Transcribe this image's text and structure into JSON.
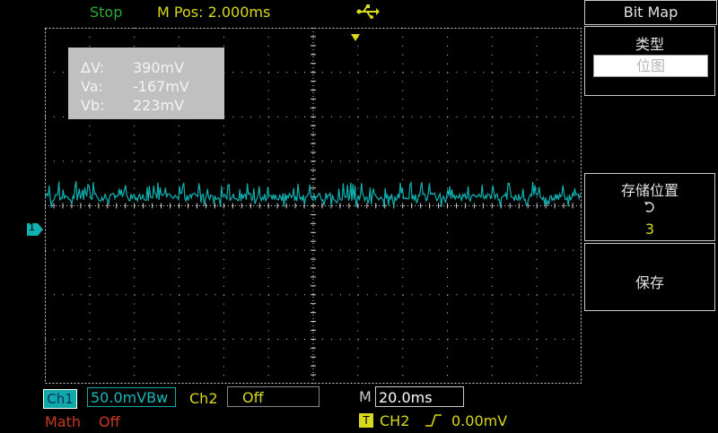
{
  "status": {
    "run_state": "Stop",
    "m_pos": "M Pos: 2.000ms",
    "usb_icon": "usb-icon"
  },
  "cursor": {
    "rows": [
      {
        "label": "ΔV:",
        "value": "390mV"
      },
      {
        "label": "Va:",
        "value": "-167mV"
      },
      {
        "label": "Vb:",
        "value": "223mV"
      }
    ]
  },
  "menu": {
    "title": "Bit Map",
    "type_label": "类型",
    "type_value": "位图",
    "location_label": "存储位置",
    "location_value": "3",
    "save_label": "保存",
    "refresh_icon": "refresh-icon"
  },
  "channel": {
    "ch1_label": "Ch1",
    "ch1_scale": "50.0mVBw",
    "ch2_label": "Ch2",
    "ch2_state": "Off",
    "marker": "1"
  },
  "timebase": {
    "label": "M",
    "value": "20.0ms"
  },
  "math": {
    "label": "Math",
    "state": "Off"
  },
  "trigger": {
    "badge": "T",
    "source": "CH2",
    "level": "0.00mV"
  },
  "colors": {
    "trace": "#12b0b0",
    "grid": "#cfcfcf",
    "yellow": "#d8d81c",
    "green": "#2ea836",
    "red": "#c83a1e"
  }
}
